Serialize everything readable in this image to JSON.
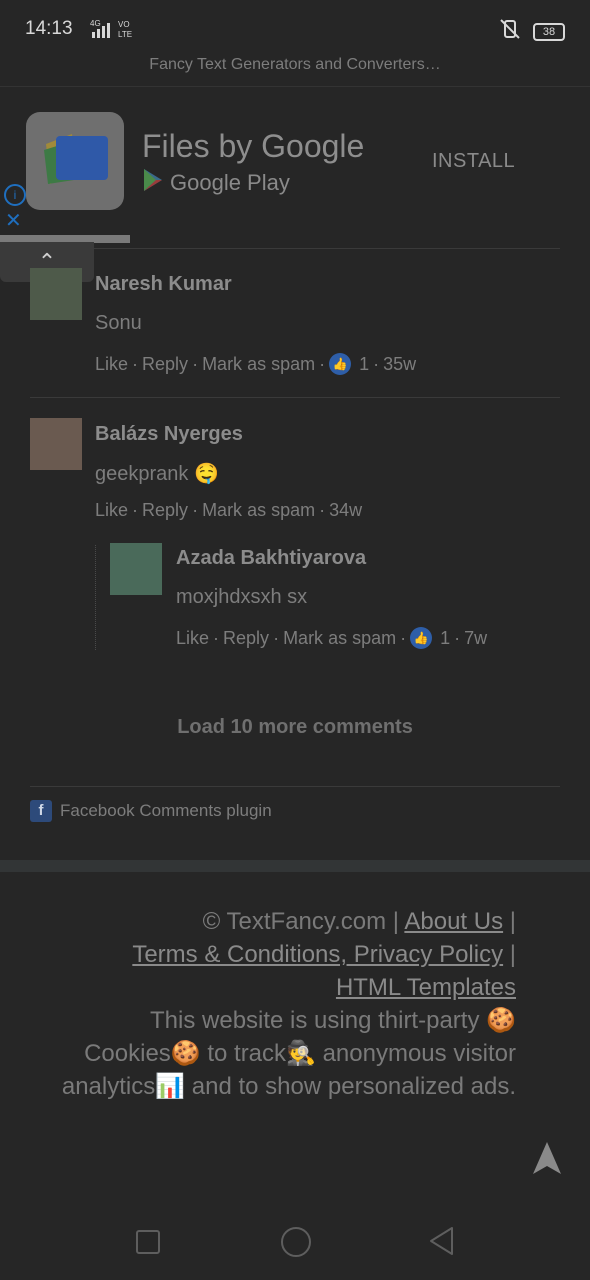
{
  "status": {
    "time": "14:13",
    "network": "4G",
    "volte": "VO LTE",
    "battery": "38"
  },
  "page": {
    "title": "Fancy Text Generators and Converters…"
  },
  "ad": {
    "title": "Files by Google",
    "store": "Google Play",
    "install_label": "INSTALL",
    "info_icon": "i",
    "close_icon": "✕"
  },
  "comments": [
    {
      "name": "Naresh Kumar",
      "text": "Sonu",
      "like": "Like",
      "reply": "Reply",
      "spam": "Mark as spam",
      "likes": "1",
      "time": "35w"
    },
    {
      "name": "Balázs Nyerges",
      "text": "geekprank 🤤",
      "like": "Like",
      "reply": "Reply",
      "spam": "Mark as spam",
      "time": "34w"
    },
    {
      "name": "Azada Bakhtiyarova",
      "text": "moxjhdxsxh sx",
      "like": "Like",
      "reply": "Reply",
      "spam": "Mark as spam",
      "likes": "1",
      "time": "7w"
    }
  ],
  "load_more": "Load 10 more comments",
  "plugin_label": "Facebook Comments plugin",
  "footer": {
    "copyright": "© TextFancy.com |",
    "about": "About Us",
    "bar1": "|",
    "terms": "Terms & Conditions, Privacy Policy",
    "bar2": "|",
    "templates": "HTML Templates",
    "notice": "This website is using thirt-party 🍪 Cookies🍪 to track🕵️ anonymous visitor analytics📊 and to show personalized ads."
  }
}
